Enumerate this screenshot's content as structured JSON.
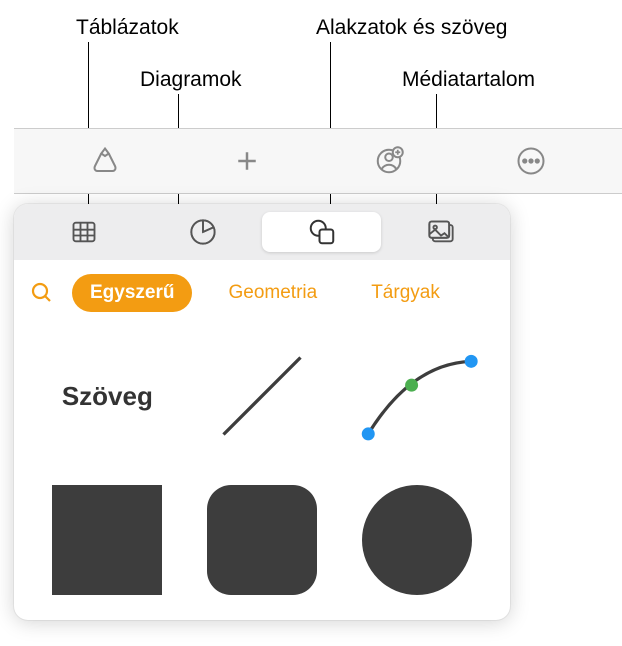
{
  "callouts": {
    "tables": "Táblázatok",
    "charts": "Diagramok",
    "shapes_text": "Alakzatok és szöveg",
    "media": "Médiatartalom"
  },
  "segments": {
    "tables": "tables-tab",
    "charts": "charts-tab",
    "shapes": "shapes-tab",
    "media": "media-tab"
  },
  "categories": {
    "simple": "Egyszerű",
    "geometry": "Geometria",
    "objects": "Tárgyak"
  },
  "shapes": {
    "text_label": "Szöveg"
  }
}
